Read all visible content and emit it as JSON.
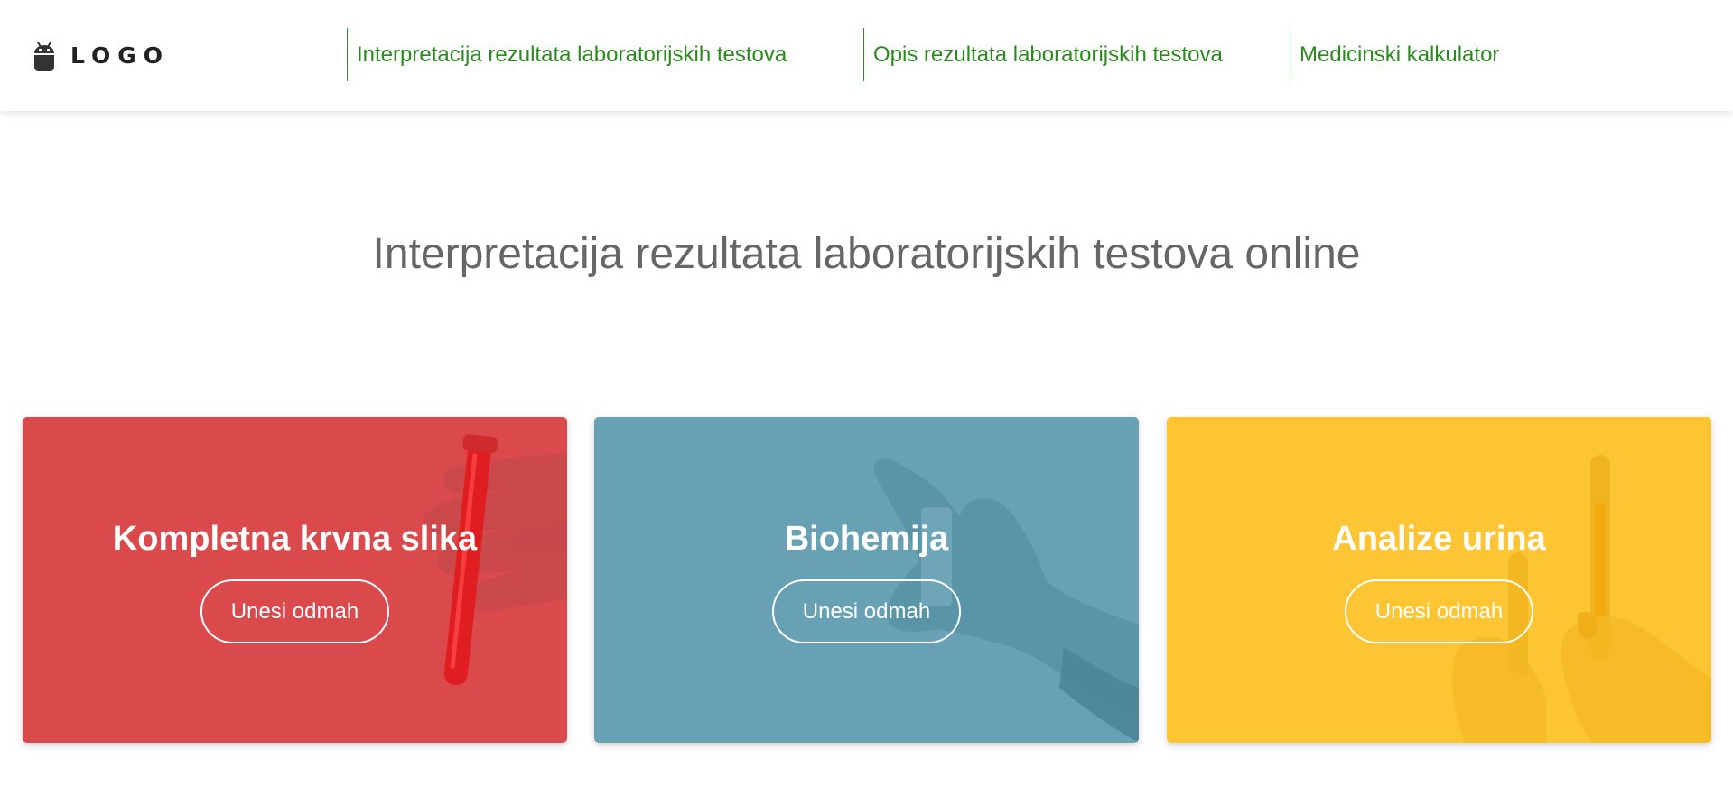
{
  "header": {
    "logo_text": "LOGO",
    "logo_icon": "android-icon",
    "nav": [
      {
        "label": "Interpretacija rezultata laboratorijskih testova"
      },
      {
        "label": "Opis rezultata laboratorijskih testova"
      },
      {
        "label": "Medicinski kalkulator"
      }
    ],
    "nav_color": "#2a8a1e"
  },
  "hero": {
    "title": "Interpretacija rezultata laboratorijskih testova online"
  },
  "cards": [
    {
      "title": "Kompletna krvna slika",
      "button_label": "Unesi odmah",
      "color": "#da4a4d",
      "art": "test-tube-in-gloved-hand"
    },
    {
      "title": "Biohemija",
      "button_label": "Unesi odmah",
      "color": "#68a1b3",
      "art": "gloved-hand-holding-vial"
    },
    {
      "title": "Analize urina",
      "button_label": "Unesi odmah",
      "color": "#fdc533",
      "art": "urine-sample-tubes-in-hands"
    }
  ]
}
